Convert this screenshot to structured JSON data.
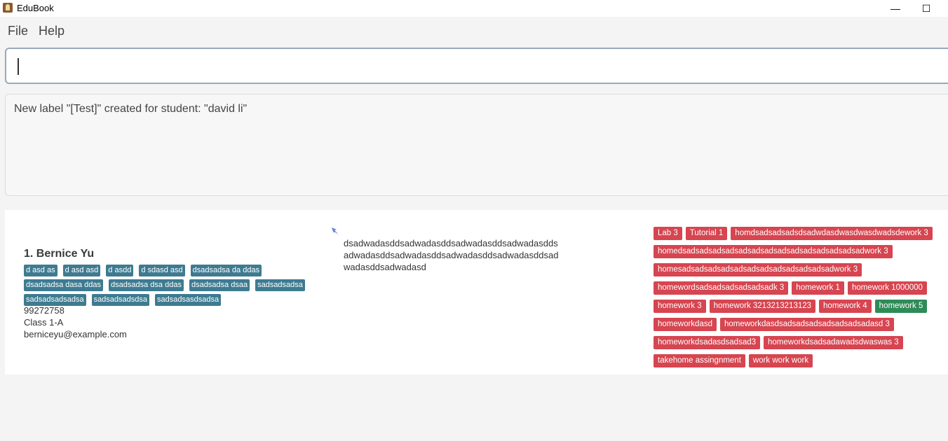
{
  "window": {
    "title": "EduBook",
    "minimize_glyph": "—",
    "maximize_glyph": "☐"
  },
  "menu": {
    "file": "File",
    "help": "Help"
  },
  "command": {
    "value": "",
    "placeholder": ""
  },
  "result": {
    "message": "New label \"[Test]\" created for student: \"david li\""
  },
  "student": {
    "index_name": "1.  Bernice Yu",
    "tags_row1": [
      "d asd as",
      "d asd asd",
      "d asdd",
      "d sdasd asd",
      "dsadsadsa da ddas"
    ],
    "tags_row2": [
      "dsadsadsa dasa ddas",
      "dsadsadsa dsa ddas",
      "dsadsadsa dsaa",
      "sadsadsadsa"
    ],
    "tags_row3": [
      "sadsadsadsadsa",
      "sadsadsadsdsa",
      "sadsadsasdsadsa"
    ],
    "phone": "99272758",
    "class": "Class 1-A",
    "email": "berniceyu@example.com",
    "notes": "dsadwadasddsadwadasddsadwadasddsadwadasdds adwadasddsadwadasddsadwadasddsadwadasddsad wadasddsadwadasd",
    "labels": [
      {
        "text": "Lab 3",
        "color": "red"
      },
      {
        "text": "Tutorial 1",
        "color": "red"
      },
      {
        "text": "homdsadsadsadsdsadwdasdwasdwasdwadsdework 3",
        "color": "red"
      },
      {
        "text": "homedsadsadsadsadsadsadsadsadsadsadsadsadsadsadwork 3",
        "color": "red"
      },
      {
        "text": "homesadsadsadsadsadsadsadsadsadsadsadsadwork 3",
        "color": "red"
      },
      {
        "text": "homewordsadsadsadsadsadsadk 3",
        "color": "red"
      },
      {
        "text": "homework 1",
        "color": "red"
      },
      {
        "text": "homework 1000000",
        "color": "red"
      },
      {
        "text": "homework 3",
        "color": "red"
      },
      {
        "text": "homework 3213213213123",
        "color": "red"
      },
      {
        "text": "homework 4",
        "color": "red"
      },
      {
        "text": "homework 5",
        "color": "green"
      },
      {
        "text": "homeworkdasd",
        "color": "red"
      },
      {
        "text": "homeworkdasdsadsadsadsadsadsadsadasd 3",
        "color": "red"
      },
      {
        "text": "homeworkdsadasdsadsad3",
        "color": "red"
      },
      {
        "text": "homeworkdsadsadawadsdwaswas 3",
        "color": "red"
      },
      {
        "text": "takehome assingnment",
        "color": "red"
      },
      {
        "text": "work work work",
        "color": "red"
      }
    ]
  },
  "colors": {
    "tag_blue": "#3e7b91",
    "tag_red": "#d64550",
    "tag_green": "#2e8b57"
  }
}
